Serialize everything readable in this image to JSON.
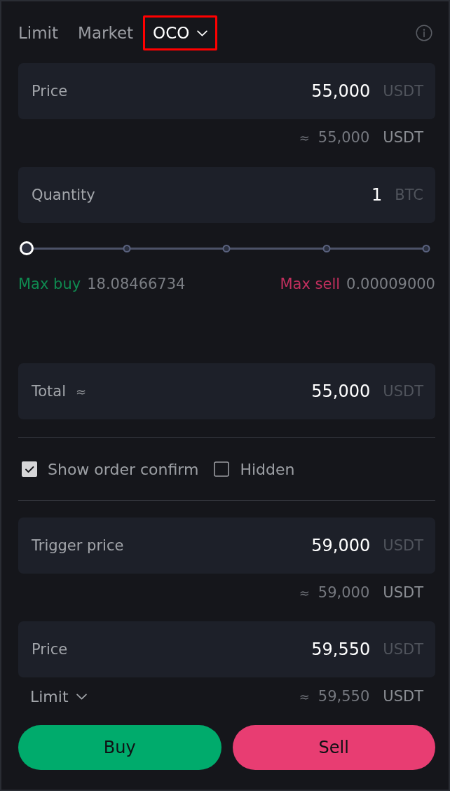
{
  "order_types": [
    {
      "label": "Limit",
      "selected": false,
      "highlighted": false,
      "dropdown": false
    },
    {
      "label": "Market",
      "selected": false,
      "highlighted": false,
      "dropdown": false
    },
    {
      "label": "OCO",
      "selected": true,
      "highlighted": true,
      "dropdown": true
    }
  ],
  "price_field": {
    "label": "Price",
    "value": "55,000",
    "unit": "USDT",
    "hint": {
      "sign": "≈",
      "amount": "55,000",
      "unit": "USDT"
    }
  },
  "quantity_field": {
    "label": "Quantity",
    "value": "1",
    "unit": "BTC"
  },
  "quantity_slider": {
    "level": 0
  },
  "balances": [
    {
      "label": "Max buy",
      "value": "18.08466734",
      "color": "#0f8a50"
    },
    {
      "label": "Max sell",
      "value": "0.00009000",
      "color": "#c22f5e"
    }
  ],
  "total_field": {
    "label": "Total",
    "sign": "≈",
    "value": "55,000",
    "unit": "USDT"
  },
  "options": [
    {
      "label": "Show order confirm",
      "checked": true
    },
    {
      "label": "Hidden",
      "checked": false
    }
  ],
  "trigger_field": {
    "label": "Trigger price",
    "value": "59,000",
    "unit": "USDT",
    "hint": {
      "sign": "≈",
      "amount": "59,000",
      "unit": "USDT"
    }
  },
  "limit_price_field": {
    "label": "Price",
    "value": "59,550",
    "unit": "USDT",
    "type_selector": {
      "label": "Limit"
    },
    "hint": {
      "sign": "≈",
      "amount": "59,550",
      "unit": "USDT"
    }
  },
  "actions": [
    {
      "label": "Buy",
      "kind": "buy"
    },
    {
      "label": "Sell",
      "kind": "sell"
    }
  ]
}
